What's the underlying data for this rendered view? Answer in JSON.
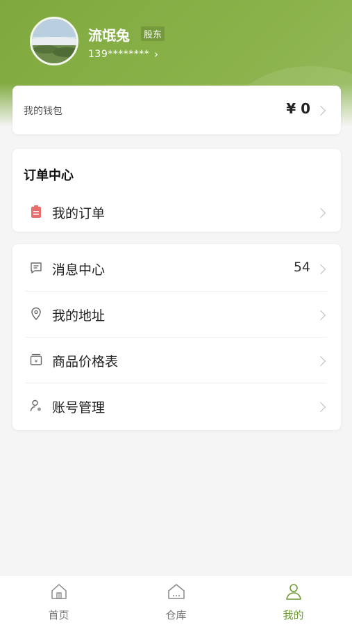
{
  "profile": {
    "name": "流氓兔",
    "badge": "股东",
    "phone": "139********"
  },
  "wallet": {
    "label": "我的钱包",
    "amount": "¥ 0"
  },
  "orders": {
    "title": "订单中心",
    "my_orders": "我的订单"
  },
  "menu": {
    "items": [
      {
        "label": "消息中心",
        "value": "54",
        "icon": "message-icon"
      },
      {
        "label": "我的地址",
        "value": "",
        "icon": "location-pin-icon"
      },
      {
        "label": "商品价格表",
        "value": "",
        "icon": "price-list-icon"
      },
      {
        "label": "账号管理",
        "value": "",
        "icon": "user-settings-icon"
      }
    ]
  },
  "tabbar": {
    "items": [
      {
        "label": "首页",
        "icon": "home-icon"
      },
      {
        "label": "仓库",
        "icon": "warehouse-icon"
      },
      {
        "label": "我的",
        "icon": "profile-icon",
        "active": true
      }
    ]
  },
  "colors": {
    "brand": "#8ab24a",
    "active_tab": "#6d9a33",
    "order_icon": "#e86d6d"
  }
}
